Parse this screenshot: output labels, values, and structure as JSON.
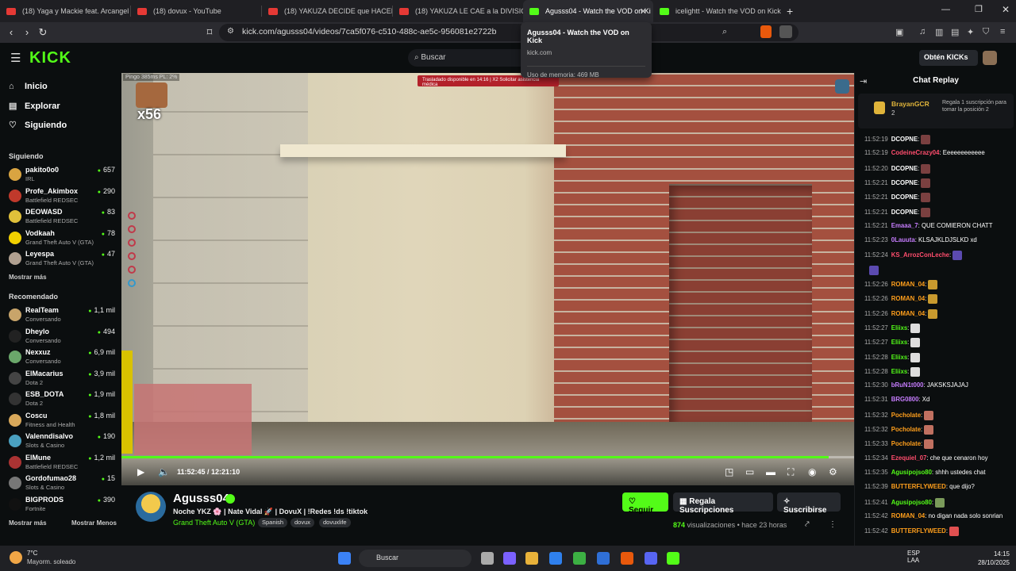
{
  "browser": {
    "tabs": [
      {
        "label": "(18) Yaga y Mackie feat. Arcangel y d",
        "type": "youtube"
      },
      {
        "label": "(18) dovux - YouTube",
        "type": "youtube"
      },
      {
        "label": "(18) YAKUZA DECIDE que HACER con",
        "type": "youtube"
      },
      {
        "label": "(18) YAKUZA LE CAE a la DIVISION P",
        "type": "youtube"
      },
      {
        "label": "Agusss04 - Watch the VOD on Ki",
        "type": "kick",
        "active": true
      },
      {
        "label": "icelightt - Watch the VOD on Kick",
        "type": "kick"
      }
    ],
    "new_tab": "+",
    "url": "kick.com/agusss04/videos/7ca5f076-c510-488c-ae5c-956081e2722b",
    "tooltip": {
      "title": "Agusss04 - Watch the VOD on Kick",
      "domain": "kick.com",
      "memory": "Uso de memoria: 469 MB"
    }
  },
  "header": {
    "logo": "KICK",
    "search_placeholder": "Buscar",
    "kicks_button": "Obtén KICKs"
  },
  "sidebar": {
    "nav": [
      {
        "label": "Inicio",
        "icon": "home-icon"
      },
      {
        "label": "Explorar",
        "icon": "compass-icon"
      },
      {
        "label": "Siguiendo",
        "icon": "heart-icon"
      }
    ],
    "following_title": "Siguiendo",
    "following": [
      {
        "name": "pakito0o0",
        "game": "IRL",
        "viewers": "657",
        "color": "#d9a441"
      },
      {
        "name": "Profe_Akimbox",
        "game": "Battlefield REDSEC",
        "viewers": "290",
        "color": "#c0392b"
      },
      {
        "name": "DEOWASD",
        "game": "Battlefield REDSEC",
        "viewers": "83",
        "color": "#e0c03a"
      },
      {
        "name": "Vodkaah",
        "game": "Grand Theft Auto V (GTA)",
        "viewers": "78",
        "color": "#f1d000"
      },
      {
        "name": "Leyespa",
        "game": "Grand Theft Auto V (GTA)",
        "viewers": "47",
        "color": "#b0a090"
      }
    ],
    "show_more": "Mostrar más",
    "recommended_title": "Recomendado",
    "recommended": [
      {
        "name": "RealTeam",
        "game": "Conversando",
        "viewers": "1,1 mil",
        "color": "#c8a46a"
      },
      {
        "name": "Dheylo",
        "game": "Conversando",
        "viewers": "494",
        "color": "#222"
      },
      {
        "name": "Nexxuz",
        "game": "Conversando",
        "viewers": "6,9 mil",
        "color": "#6aa76a"
      },
      {
        "name": "ElMacarius",
        "game": "Dota 2",
        "viewers": "3,9 mil",
        "color": "#444"
      },
      {
        "name": "ESB_DOTA",
        "game": "Dota 2",
        "viewers": "1,9 mil",
        "color": "#333"
      },
      {
        "name": "Coscu",
        "game": "Fitness and Health",
        "viewers": "1,8 mil",
        "color": "#d8a85a"
      },
      {
        "name": "Valenndisalvo",
        "game": "Slots & Casino",
        "viewers": "190",
        "color": "#4aa0c0"
      },
      {
        "name": "ElMune",
        "game": "Battlefield REDSEC",
        "viewers": "1,2 mil",
        "color": "#a33"
      },
      {
        "name": "Gordofumao28",
        "game": "Slots & Casino",
        "viewers": "15",
        "color": "#777"
      },
      {
        "name": "BIGPRODS",
        "game": "Fortnite",
        "viewers": "390",
        "color": "#111"
      }
    ],
    "show_more_2": "Mostrar más",
    "show_less": "Mostrar Menos"
  },
  "video": {
    "hud_ping": "Pingo 385ms    PL: 2%",
    "hud_banner": "Trasladado disponible en 14:16 | X2 Solicitar asistencia médica",
    "multiplier": "x56",
    "time_current": "11:52:45",
    "time_total": "12:21:10",
    "time_sep": " / ",
    "progress": 0.965
  },
  "channel": {
    "name": "Agusss04",
    "title": "Noche YKZ 🌸 | Nate Vidal 🚀 | DovuX | !Redes !ds !tiktok",
    "game": "Grand Theft Auto V (GTA)",
    "tags": [
      "Spanish",
      "dovux",
      "dovuxlife"
    ],
    "follow": "Seguir",
    "gift": "Regala Suscripciones",
    "subscribe": "Suscribirse",
    "views_count": "874",
    "views_label": "visualizaciones",
    "ago": "• hace 23 horas"
  },
  "chat": {
    "title": "Chat Replay",
    "pinned": {
      "user": "BrayanGCR",
      "count": "2",
      "message": "Regala 1 suscripción para tomar la posición 2"
    },
    "messages": [
      {
        "time": "11:52:19",
        "user": "DCOPNE",
        "color": "#ffffff",
        "text": ":",
        "emote": "#7a4040"
      },
      {
        "time": "11:52:19",
        "user": "CodeineCrazy04",
        "color": "#ff4d6d",
        "text": ": Eeeeeeeeeeee"
      },
      {
        "time": "11:52:20",
        "user": "DCOPNE",
        "color": "#ffffff",
        "text": ":",
        "emote": "#7a4040"
      },
      {
        "time": "11:52:21",
        "user": "DCOPNE",
        "color": "#ffffff",
        "text": ":",
        "emote": "#7a4040"
      },
      {
        "time": "11:52:21",
        "user": "DCOPNE",
        "color": "#ffffff",
        "text": ":",
        "emote": "#7a4040"
      },
      {
        "time": "11:52:21",
        "user": "DCOPNE",
        "color": "#ffffff",
        "text": ":",
        "emote": "#7a4040"
      },
      {
        "time": "11:52:21",
        "user": "Emaaa_7",
        "color": "#c77dff",
        "text": ": QUE COMIERON CHATT"
      },
      {
        "time": "11:52:23",
        "user": "0Lauuta",
        "color": "#c77dff",
        "text": ": KLSAJKLDJSLKD xd"
      },
      {
        "time": "11:52:24",
        "user": "KS_ArrozConLeche",
        "color": "#ff4d6d",
        "text": ":",
        "emote": "#5b4ab0"
      },
      {
        "time": "",
        "user": "",
        "color": "#ffffff",
        "text": "",
        "emote": "#5b4ab0"
      },
      {
        "time": "11:52:26",
        "user": "ROMAN_04",
        "color": "#ff9f1c",
        "text": ":",
        "emote": "#c99a2e"
      },
      {
        "time": "11:52:26",
        "user": "ROMAN_04",
        "color": "#ff9f1c",
        "text": ":",
        "emote": "#c99a2e"
      },
      {
        "time": "11:52:26",
        "user": "ROMAN_04",
        "color": "#ff9f1c",
        "text": ":",
        "emote": "#c99a2e"
      },
      {
        "time": "11:52:27",
        "user": "Eliixs",
        "color": "#53fc18",
        "text": ":",
        "emote": "#dddddd"
      },
      {
        "time": "11:52:27",
        "user": "Eliixs",
        "color": "#53fc18",
        "text": ":",
        "emote": "#dddddd"
      },
      {
        "time": "11:52:28",
        "user": "Eliixs",
        "color": "#53fc18",
        "text": ":",
        "emote": "#dddddd"
      },
      {
        "time": "11:52:28",
        "user": "Eliixs",
        "color": "#53fc18",
        "text": ":",
        "emote": "#dddddd"
      },
      {
        "time": "11:52:30",
        "user": "bRuN1t000",
        "color": "#c77dff",
        "text": ": JAKSKSJAJAJ"
      },
      {
        "time": "11:52:31",
        "user": "BRG0800",
        "color": "#c77dff",
        "text": ": Xd"
      },
      {
        "time": "11:52:32",
        "user": "Pocholate",
        "color": "#ff9f1c",
        "text": ":",
        "emote": "#c07060"
      },
      {
        "time": "11:52:32",
        "user": "Pocholate",
        "color": "#ff9f1c",
        "text": ":",
        "emote": "#c07060"
      },
      {
        "time": "11:52:33",
        "user": "Pocholate",
        "color": "#ff9f1c",
        "text": ":",
        "emote": "#c07060"
      },
      {
        "time": "11:52:34",
        "user": "Ezequiel_07",
        "color": "#ff4d6d",
        "text": ": che que cenaron hoy"
      },
      {
        "time": "11:52:35",
        "user": "Agusipojso80",
        "color": "#53fc18",
        "text": ": shhh ustedes chat"
      },
      {
        "time": "11:52:39",
        "user": "BUTTERFLYWEED",
        "color": "#ff9f1c",
        "text": ": que dijo?"
      },
      {
        "time": "11:52:41",
        "user": "Agusipojso80",
        "color": "#53fc18",
        "text": ":",
        "emote": "#7a9a5a"
      },
      {
        "time": "11:52:42",
        "user": "ROMAN_04",
        "color": "#ff9f1c",
        "text": ": no digan nada solo sonrian"
      },
      {
        "time": "11:52:42",
        "user": "BUTTERFLYWEED",
        "color": "#ff9f1c",
        "text": ":",
        "emote": "#e05050"
      }
    ]
  },
  "taskbar": {
    "temp": "7°C",
    "weather": "Mayorm. soleado",
    "search": "Buscar",
    "lang": "ESP",
    "lang2": "LAA",
    "time": "14:15",
    "date": "28/10/2025"
  }
}
